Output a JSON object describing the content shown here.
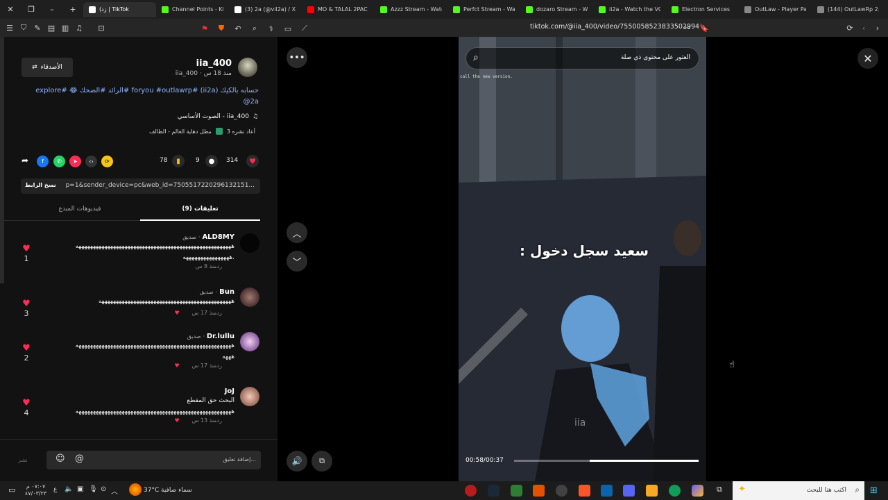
{
  "tabs": [
    {
      "label": "(زد | TikTok",
      "color": "#ffffff"
    },
    {
      "label": "Channel Points - Ki",
      "color": "#53fc18"
    },
    {
      "label": "(3) 2a (@vil2a) / X",
      "color": "#ffffff"
    },
    {
      "label": "MO & TALAL 2PAC",
      "color": "#ff0000"
    },
    {
      "label": "Azzz Stream - Watc",
      "color": "#53fc18"
    },
    {
      "label": "Perfct Stream - Watc",
      "color": "#53fc18"
    },
    {
      "label": "dozaro Stream - W",
      "color": "#53fc18"
    },
    {
      "label": "ii2a - Watch the VO",
      "color": "#53fc18"
    },
    {
      "label": "Electron Services",
      "color": "#53fc18"
    },
    {
      "label": "OutLaw - Player Pag",
      "color": "#888888"
    },
    {
      "label": "(144) OutLawRp 2.0",
      "color": "#888888"
    }
  ],
  "url": "tiktok.com/@iia_400/video/7550058523833502994",
  "profile": {
    "display_name": "iia_400",
    "handle_time": "iia_400 · منذ 18 س",
    "friends_button": "الأصدقاء",
    "caption_line1": "حسابه بالكيك (ii2a) #foryou #outlawrp #الرائد #الضحك 😂 #explore",
    "caption_line2": "@2a",
    "sound": "الصوت الأساسي - iia_400",
    "repost": "3 أعاد نشره",
    "playlist": "مطل دهاية العالم - الطالف"
  },
  "stats": {
    "likes": "314",
    "comments": "9",
    "saves": "78"
  },
  "link": {
    "text": "p=1&sender_device=pc&web_id=7505517220296132151...",
    "copy_label": "نسخ الرابط"
  },
  "tabs_panel": {
    "comments_tab": "تعليقات (9)",
    "creator_tab": "فيديوهات المبدع"
  },
  "comments": [
    {
      "name": "ALD8MY",
      "badge": "صديق",
      "text1": "ههههههههههههههههههههههههههههههههههههههههههههههههههههههه",
      "text2": "ههههههههههههههههه.",
      "time": "منذ 8 س",
      "reply": "رد",
      "likes": "1"
    },
    {
      "name": "Bun",
      "badge": "صديق",
      "text1": "ههههههههههههههههههههههههههههههههههههههههههههههه",
      "text2": "",
      "time": "منذ 17 س",
      "reply": "رد",
      "likes": "3"
    },
    {
      "name": "Dr.lullu",
      "badge": "صديق",
      "text1": "ههههههههههههههههههههههههههههههههههههههههههههههههههههههه",
      "text2": "هههه",
      "time": "منذ 17 س",
      "reply": "رد",
      "likes": "2"
    },
    {
      "name": "JoJ",
      "badge": "",
      "text1": "البحث حق المقطع",
      "text2": "ههههههههههههههههههههههههههههههههههههههههههههههههههههههه",
      "time": "منذ 13 س",
      "reply": "رد",
      "likes": "4"
    }
  ],
  "comment_input": {
    "placeholder": "إضافة تعليق...",
    "post": "نشر"
  },
  "video": {
    "search_placeholder": "العثور على محتوى ذي صلة",
    "overlay_text": "سعيد سجل دخول :",
    "watermark": "iia",
    "small_text": "call the new version.",
    "time": "00:58/00:37",
    "progress": 0.59
  },
  "taskbar": {
    "search": "اكتب هنا للبحث",
    "weather_text": "سماء صافية",
    "temperature": "37°C",
    "time": "٠٧:٠٧ م",
    "date": "٤٧/٠٣/٢٣",
    "lang": "ع"
  }
}
